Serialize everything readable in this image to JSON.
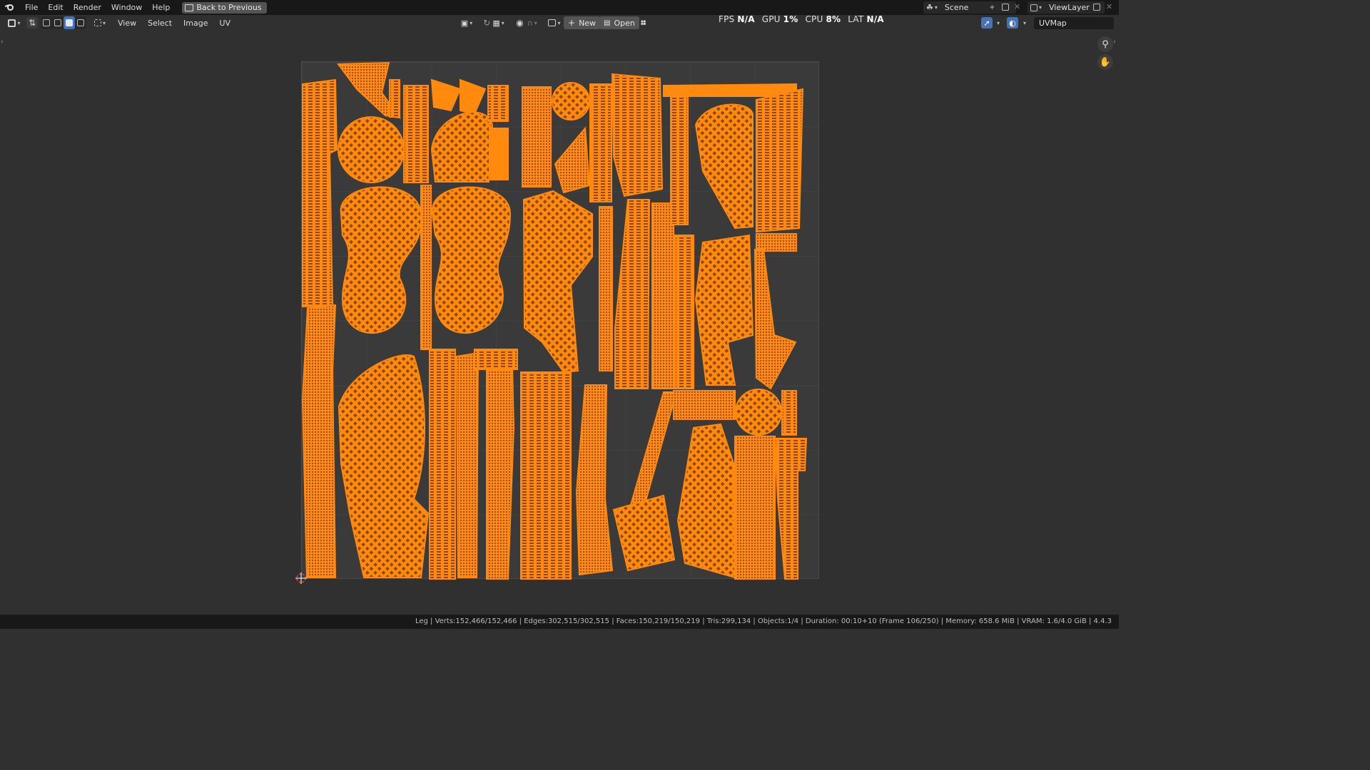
{
  "topbar": {
    "menus": [
      "File",
      "Edit",
      "Render",
      "Window",
      "Help"
    ],
    "back_button": "Back to Previous",
    "scene_name": "Scene",
    "view_layer": "ViewLayer"
  },
  "editor_header": {
    "menus": [
      "View",
      "Select",
      "Image",
      "UV"
    ],
    "new_button": "New",
    "open_button": "Open",
    "uv_map": "UVMap"
  },
  "stats": {
    "fps_label": "FPS",
    "fps_value": "N/A",
    "gpu_label": "GPU",
    "gpu_value": "1%",
    "cpu_label": "CPU",
    "cpu_value": "8%",
    "lat_label": "LAT",
    "lat_value": "N/A"
  },
  "statusbar": {
    "text": "Leg | Verts:152,466/152,466 | Edges:302,515/302,515 | Faces:150,219/150,219 | Tris:299,134 | Objects:1/4 | Duration: 00:10+10 (Frame 106/250) | Memory: 658.6 MiB | VRAM: 1.6/4.0 GiB | 4.4.3"
  },
  "colors": {
    "uv_selected": "#ff8a0d",
    "background": "#303030",
    "header_bg": "#181818",
    "accent": "#4772b3"
  },
  "icons": [
    "blender-logo",
    "back-icon",
    "editor-type-icon",
    "uv-sync-icon",
    "select-mode-icons",
    "pivot-icon",
    "snap-icon",
    "proportional-icon",
    "image-browse-icon",
    "new-plus-icon",
    "open-folder-icon",
    "pin-icon",
    "scene-icon",
    "viewlayer-icon",
    "gizmo-icon",
    "overlay-icon",
    "zoom-icon",
    "hand-icon",
    "cursor-3d-icon"
  ]
}
